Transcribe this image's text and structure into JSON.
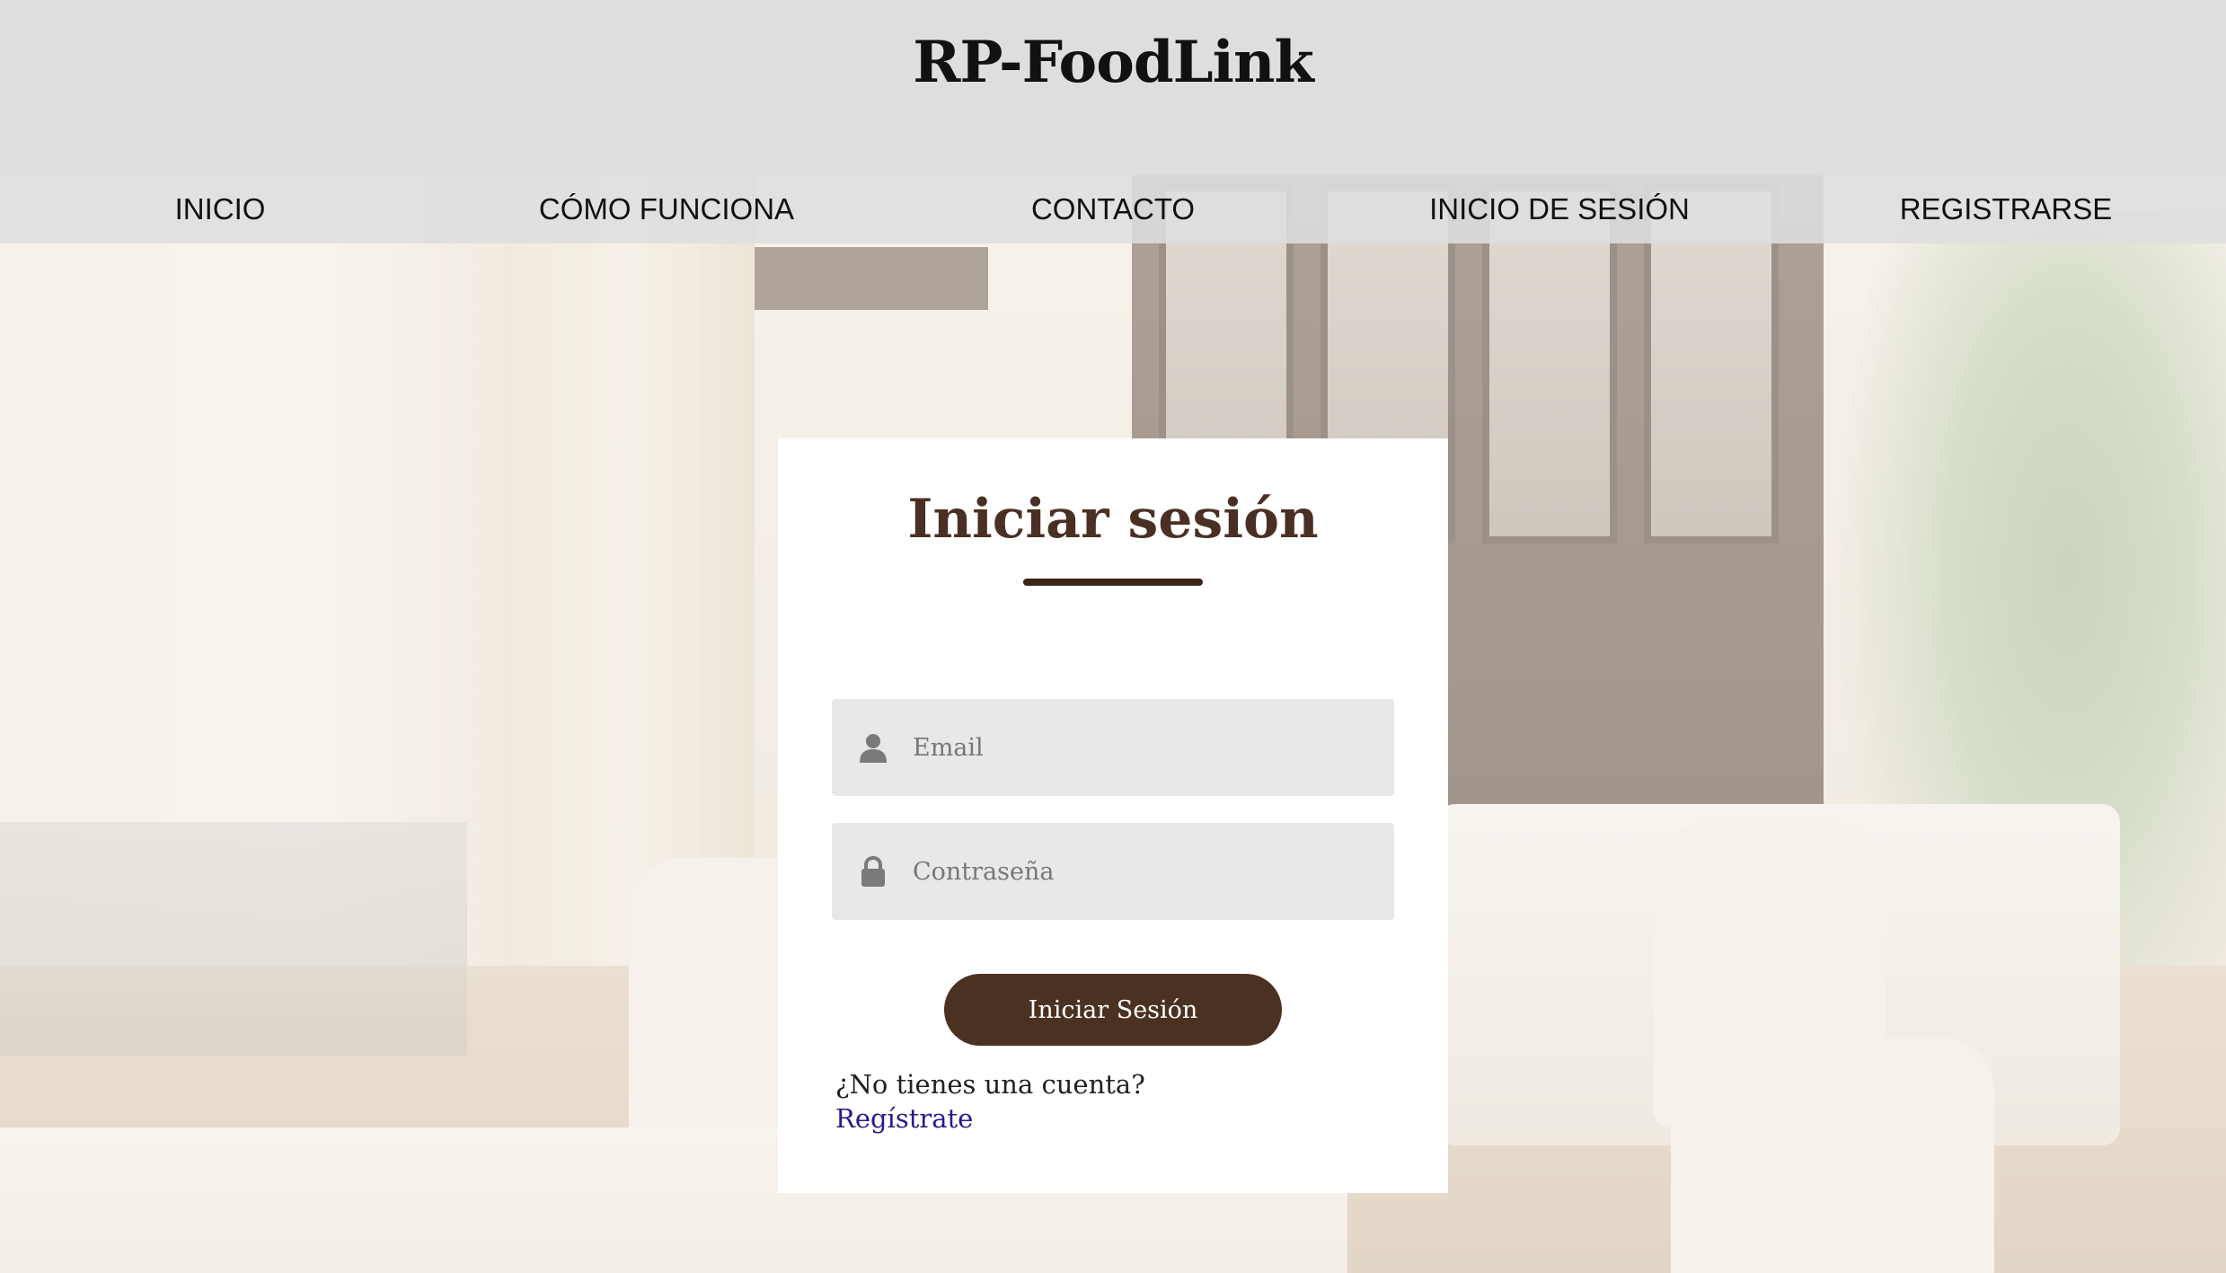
{
  "site": {
    "title": "RP-FoodLink"
  },
  "nav": {
    "items": [
      {
        "label": "INICIO"
      },
      {
        "label": "CÓMO FUNCIONA"
      },
      {
        "label": "CONTACTO"
      },
      {
        "label": "INICIO DE SESIÓN"
      },
      {
        "label": "REGISTRARSE"
      }
    ]
  },
  "login": {
    "title": "Iniciar sesión",
    "email_placeholder": "Email",
    "email_value": "",
    "password_placeholder": "Contraseña",
    "password_value": "",
    "submit_label": "Iniciar Sesión",
    "signup_prompt": "¿No tienes una cuenta?",
    "signup_link": "Regístrate",
    "email_icon": "user-icon",
    "password_icon": "lock-icon"
  },
  "colors": {
    "header_bg": "#dedede",
    "accent": "#4b3122",
    "link": "#2a1a8a",
    "field_bg": "#e8e8e8"
  }
}
